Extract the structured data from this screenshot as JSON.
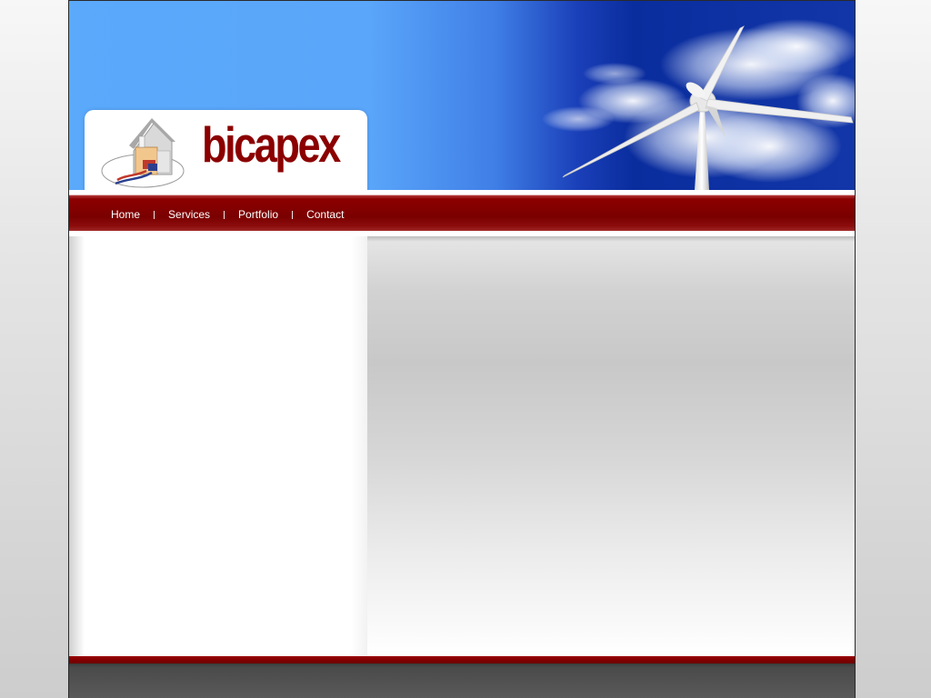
{
  "brand": {
    "name": "bicapex",
    "color": "#8b0000"
  },
  "nav": {
    "items": [
      {
        "label": "Home"
      },
      {
        "label": "Services"
      },
      {
        "label": "Portfolio"
      },
      {
        "label": "Contact"
      }
    ]
  },
  "colors": {
    "accent": "#8b0000",
    "sky": "#5aa9fb",
    "footer": "#4a4a4a"
  },
  "icons": {
    "logo": "house-heat-pump-icon",
    "header_image": "wind-turbine-image"
  }
}
